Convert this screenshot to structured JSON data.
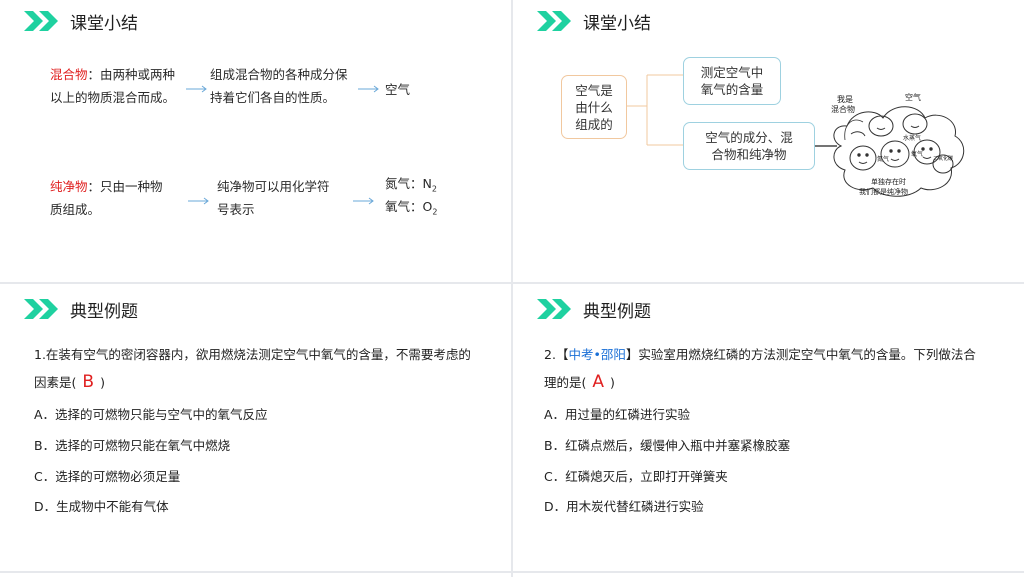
{
  "panel1": {
    "title": "课堂小结",
    "row1": {
      "term": "混合物",
      "def_a": "：由两种或两种",
      "def_b": "以上的物质混合而成。",
      "mid_a": "组成混合物的各种成分保",
      "mid_b": "持着它们各自的性质。",
      "example": "空气"
    },
    "row2": {
      "term": "纯净物",
      "def_a": "：只由一种物",
      "def_b": "质组成。",
      "mid_a": "纯净物可以用化学符",
      "mid_b": "号表示",
      "ex1_label": "氮气：N",
      "ex1_sub": "2",
      "ex2_label": "氧气：O",
      "ex2_sub": "2"
    }
  },
  "panel2": {
    "title": "课堂小结",
    "root_lines": [
      "空气是",
      "由什么",
      "组成的"
    ],
    "branch1_lines": [
      "测定空气中",
      "氧气的含量"
    ],
    "branch2_lines": [
      "空气的成分、混",
      "合物和纯净物"
    ],
    "cartoon": {
      "top_label_lines": [
        "我是",
        "混合物"
      ],
      "label_air": "空气",
      "label_n2": "氮气",
      "label_o2": "氧气",
      "label_h2o": "水蒸气",
      "label_co2": "二氧化碳",
      "bottom_lines": [
        "单独存在时",
        "我们都是纯净物"
      ]
    }
  },
  "panel3": {
    "title": "典型例题",
    "question_line1": "1.在装有空气的密闭容器内，欲用燃烧法测定空气中氧气的含量，不需要考虑的",
    "question_line2_pre": "因素是(",
    "answer": "B",
    "question_line2_post": ")",
    "options": [
      "A．选择的可燃物只能与空气中的氧气反应",
      "B．选择的可燃物只能在氧气中燃烧",
      "C．选择的可燃物必须足量",
      "D．生成物中不能有气体"
    ]
  },
  "panel4": {
    "title": "典型例题",
    "q_num": "2.",
    "bracket_open": "【",
    "source": "中考•邵阳",
    "bracket_close": "】",
    "question_line1_rest": "实验室用燃烧红磷的方法测定空气中氧气的含量。下列做法合",
    "question_line2_pre": "理的是(",
    "answer": "A",
    "question_line2_post": ")",
    "options": [
      "A．用过量的红磷进行实验",
      "B．红磷点燃后，缓慢伸入瓶中并塞紧橡胶塞",
      "C．红磷熄灭后，立即打开弹簧夹",
      "D．用木炭代替红磷进行实验"
    ]
  },
  "colors": {
    "accent_green": "#1fd1a0",
    "term_red": "#e02020",
    "arrow_blue": "#6aa8d8",
    "source_blue": "#1a6fd6",
    "node_blue_border": "#9ed1e0",
    "node_orange_border": "#f1c89f"
  }
}
